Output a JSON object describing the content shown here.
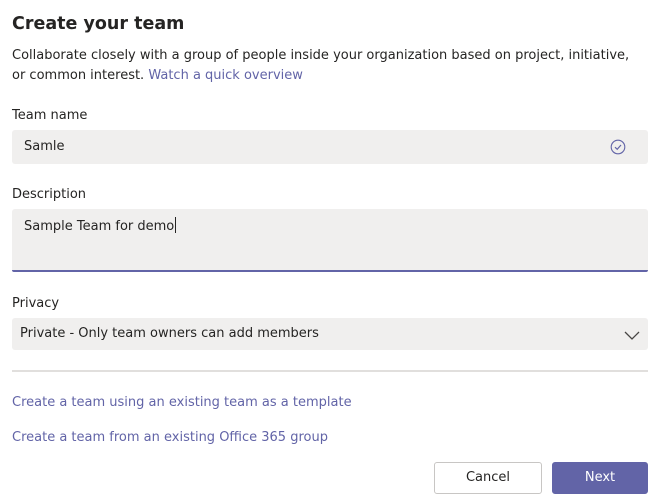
{
  "dialog": {
    "title": "Create your team",
    "intro_text": "Collaborate closely with a group of people inside your organization based on project, initiative, or common interest.",
    "intro_link": "Watch a quick overview"
  },
  "team_name": {
    "label": "Team name",
    "value": "Samle",
    "status_icon": "check-circle-icon"
  },
  "description": {
    "label": "Description",
    "value": "Sample Team for demo"
  },
  "privacy": {
    "label": "Privacy",
    "selected": "Private - Only team owners can add members",
    "icon": "chevron-down-icon"
  },
  "links": {
    "from_template": "Create a team using an existing team as a template",
    "from_o365_group": "Create a team from an existing Office 365 group"
  },
  "buttons": {
    "cancel": "Cancel",
    "next": "Next"
  },
  "colors": {
    "accent": "#6264a7",
    "field_background": "#f0efee",
    "text": "#252423"
  }
}
